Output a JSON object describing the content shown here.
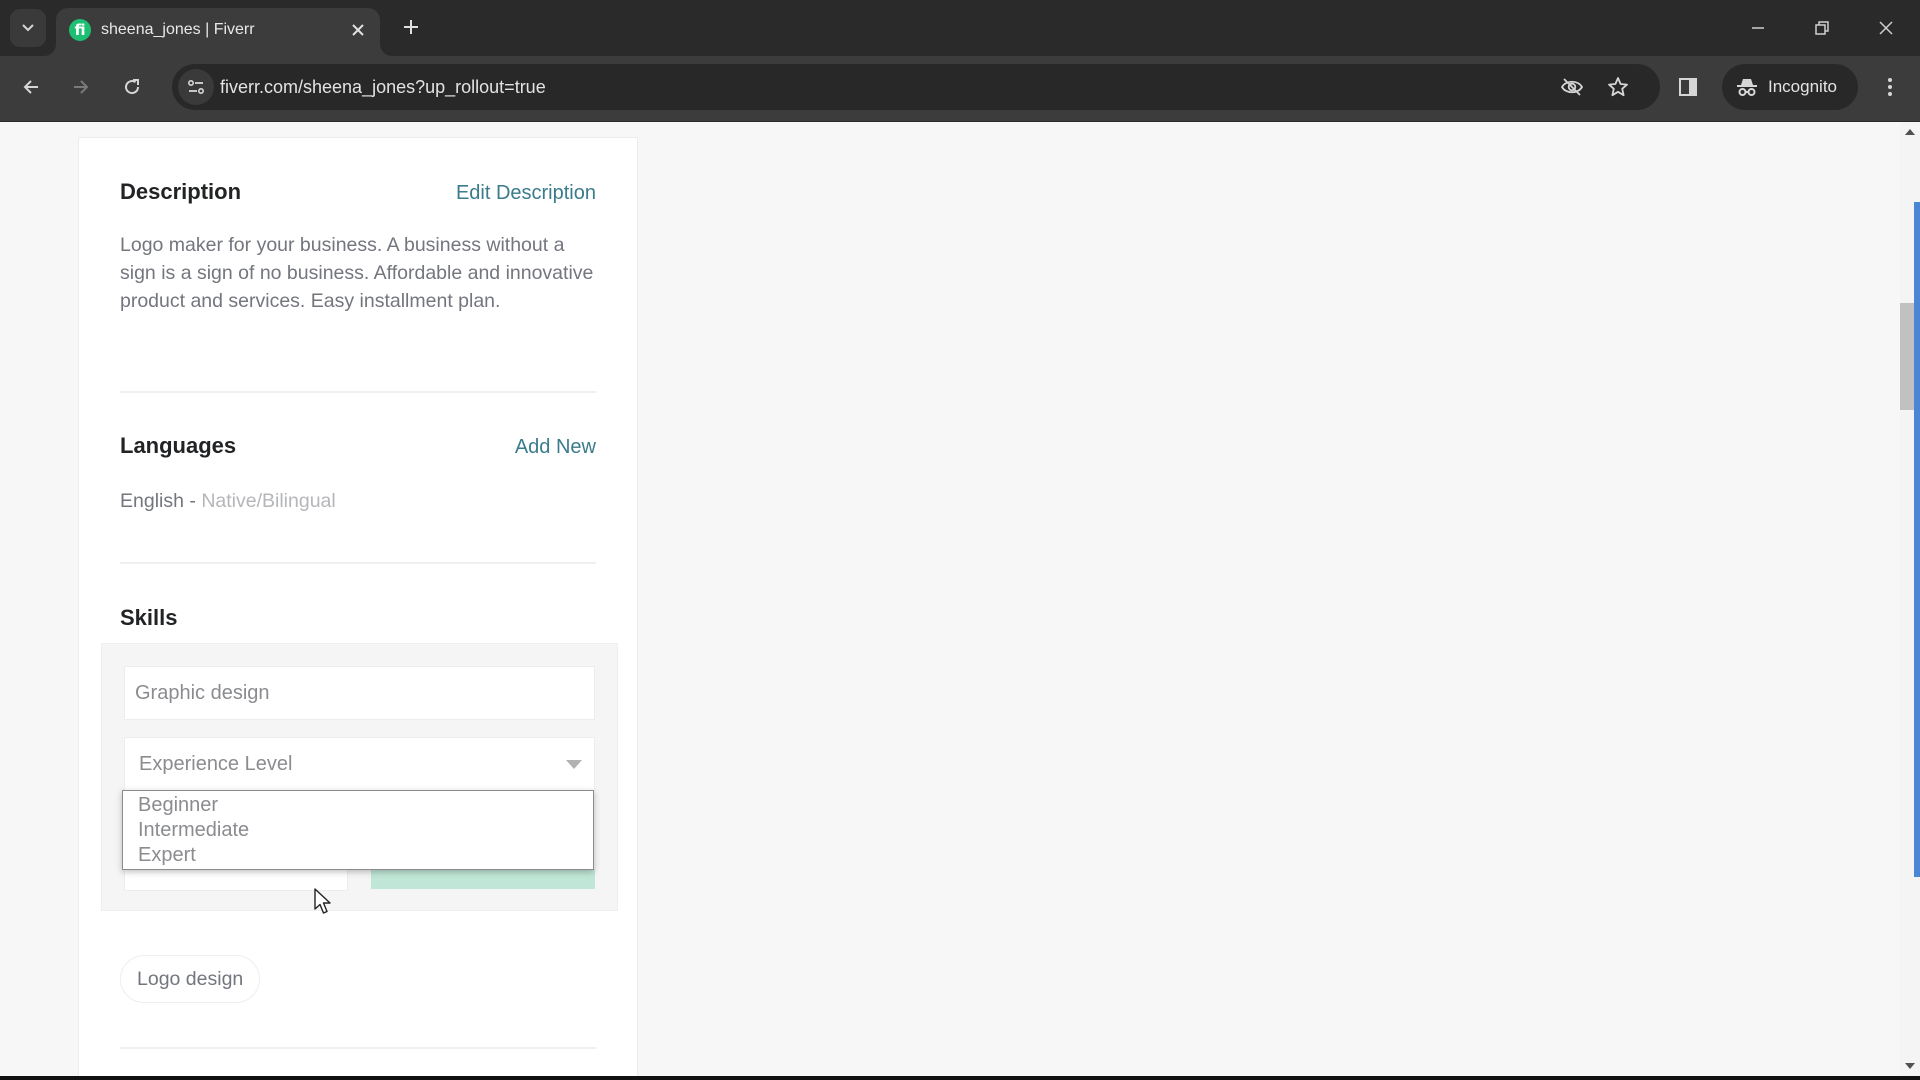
{
  "browser": {
    "tab": {
      "title": "sheena_jones | Fiverr",
      "favicon": "fiverr-icon",
      "favicon_glyph": "fi"
    },
    "tab_search_icon": "chevron-down-icon",
    "new_tab_icon": "plus-icon",
    "url": "fiverr.com/sheena_jones?up_rollout=true",
    "incognito_label": "Incognito",
    "icons": {
      "back": "arrow-left-icon",
      "forward": "arrow-right-icon",
      "reload": "reload-icon",
      "site_info": "tune-icon",
      "tracking": "eye-off-icon",
      "bookmark": "star-icon",
      "side_panel": "side-panel-icon",
      "incognito": "incognito-icon",
      "menu": "kebab-menu-icon"
    },
    "window_controls": [
      "minimize",
      "restore",
      "close"
    ]
  },
  "profile": {
    "description": {
      "title": "Description",
      "edit_label": "Edit Description",
      "text": "Logo maker for your business. A business without a sign is a sign of no business. Affordable and innovative product and services. Easy installment plan."
    },
    "languages": {
      "title": "Languages",
      "add_label": "Add New",
      "items": [
        {
          "language": "English",
          "separator": " - ",
          "level": "Native/Bilingual"
        }
      ]
    },
    "skills": {
      "title": "Skills",
      "form": {
        "skill_input_value": "Graphic design",
        "experience_placeholder": "Experience Level",
        "experience_options": [
          "Beginner",
          "Intermediate",
          "Expert"
        ],
        "dropdown_open": true
      },
      "items": [
        {
          "label": "Logo design"
        }
      ]
    }
  },
  "colors": {
    "fiverr_green": "#1dbf73",
    "link": "#3a7b8c",
    "add_button_disabled": "#bfe6d6",
    "scroll_accent": "#4a86d4"
  },
  "scroll": {
    "position_fraction": 0.2
  }
}
